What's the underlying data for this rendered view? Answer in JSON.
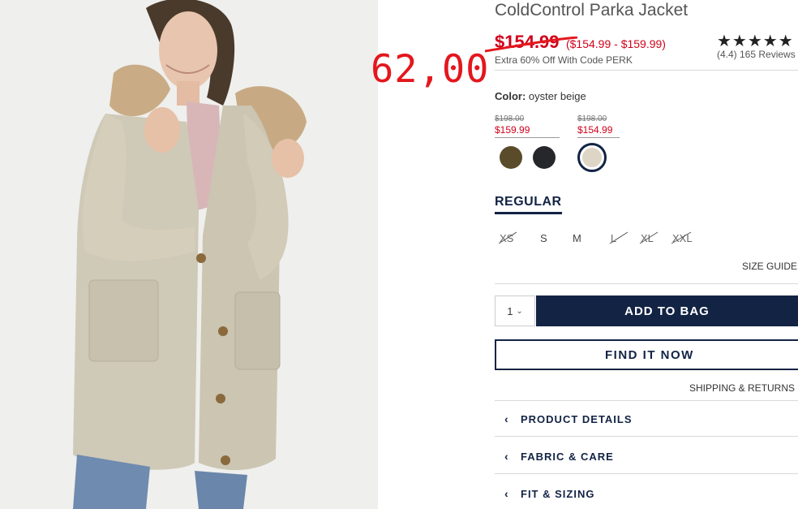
{
  "product": {
    "title": "ColdControl Parka Jacket",
    "price": "$154.99",
    "price_range": "($154.99 - $159.99)",
    "promo": "Extra 60% Off With Code PERK",
    "rating_stars": "★★★★★",
    "reviews": "(4.4) 165 Reviews"
  },
  "annotation": {
    "handwritten_price": "62,00"
  },
  "color": {
    "label": "Color:",
    "value": "oyster beige",
    "price_groups": [
      {
        "original": "$198.00",
        "sale": "$159.99"
      },
      {
        "original": "$198.00",
        "sale": "$154.99"
      }
    ],
    "swatches": [
      {
        "name": "olive",
        "hex": "#5a4b2a"
      },
      {
        "name": "black",
        "hex": "#25272b"
      },
      {
        "name": "oyster beige",
        "hex": "#ddd6c6",
        "selected": true
      }
    ]
  },
  "fit": {
    "tab": "REGULAR"
  },
  "sizes": [
    {
      "label": "XS",
      "available": false
    },
    {
      "label": "S",
      "available": true
    },
    {
      "label": "M",
      "available": true
    },
    {
      "label": "L",
      "available": false
    },
    {
      "label": "XL",
      "available": false
    },
    {
      "label": "XXL",
      "available": false
    }
  ],
  "size_guide": "SIZE GUIDE",
  "quantity": {
    "value": "1"
  },
  "buttons": {
    "add_to_bag": "ADD TO BAG",
    "find_it_now": "FIND IT NOW"
  },
  "shipping": "SHIPPING & RETURNS",
  "accordion": [
    {
      "label": "PRODUCT DETAILS"
    },
    {
      "label": "FABRIC & CARE"
    },
    {
      "label": "FIT & SIZING"
    }
  ],
  "colors": {
    "navy": "#122344",
    "sale_red": "#d0021b",
    "annotation_red": "#e3171d"
  }
}
